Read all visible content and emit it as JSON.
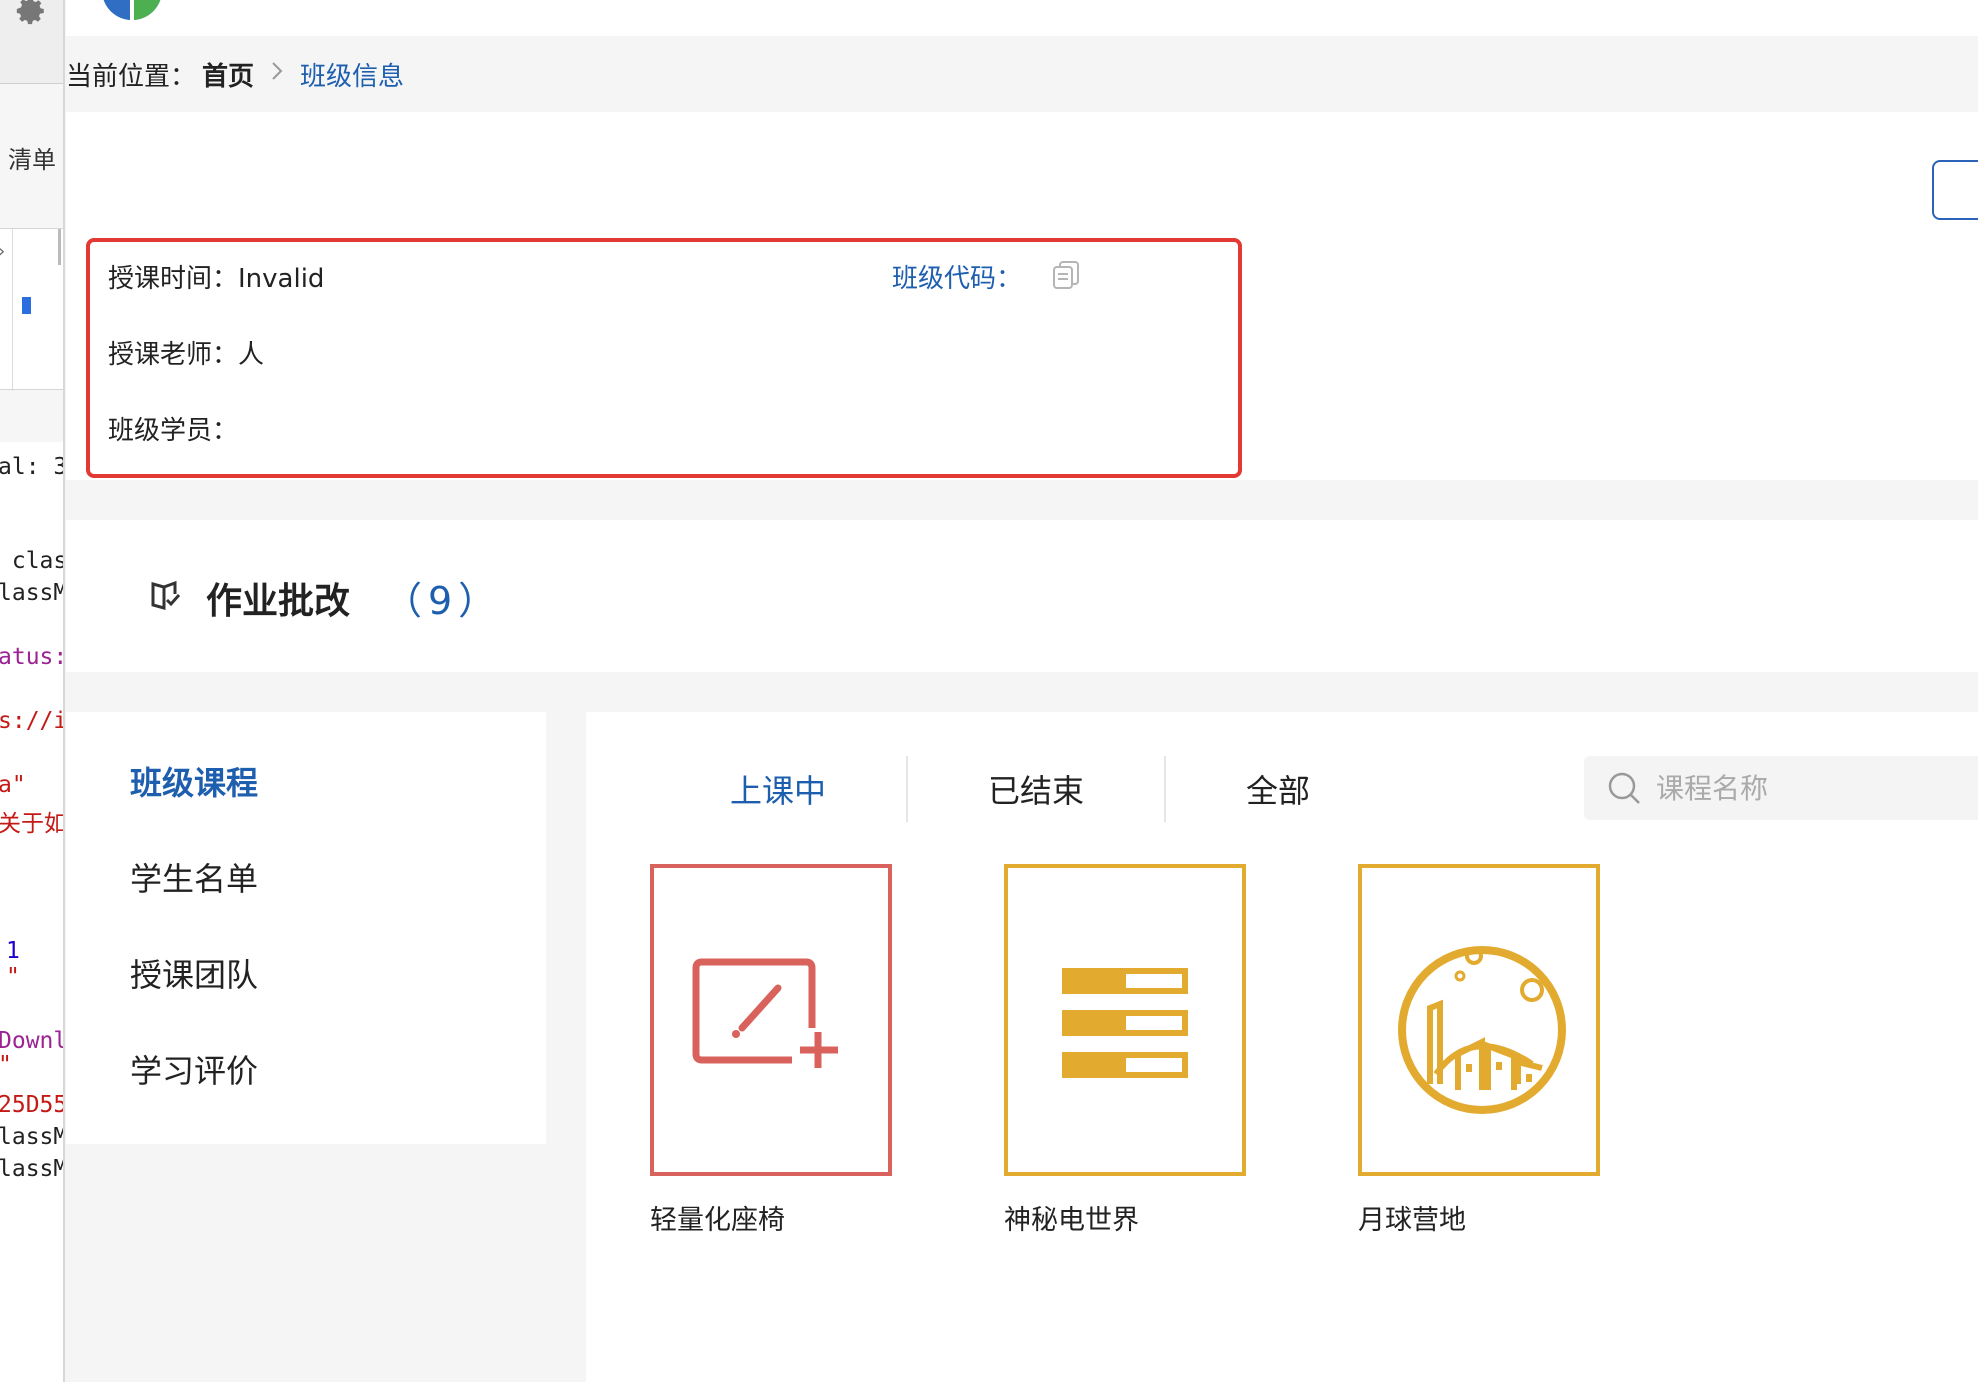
{
  "devtools": {
    "sidebar_label": "清单",
    "code_lines": [
      "al: 3",
      " clas",
      "lassM",
      "atus:",
      "s://i",
      "a\"",
      "关于如何",
      "1",
      "\"",
      "Downl",
      "\"",
      "25D55",
      "lassM",
      "lassM"
    ]
  },
  "breadcrumb": {
    "label": "当前位置：",
    "home": "首页",
    "separator": ">",
    "current": "班级信息"
  },
  "class_info": {
    "time_label": "授课时间：",
    "time_value": "Invalid",
    "teacher_label": "授课老师：",
    "teacher_value": "人",
    "students_label": "班级学员：",
    "students_value": "",
    "code_label": "班级代码："
  },
  "homework": {
    "title": "作业批改",
    "count": "（9）"
  },
  "side_menu": {
    "items": [
      {
        "label": "班级课程",
        "active": true
      },
      {
        "label": "学生名单",
        "active": false
      },
      {
        "label": "授课团队",
        "active": false
      },
      {
        "label": "学习评价",
        "active": false
      }
    ]
  },
  "tabs": [
    {
      "label": "上课中",
      "active": true
    },
    {
      "label": "已结束",
      "active": false
    },
    {
      "label": "全部",
      "active": false
    }
  ],
  "search": {
    "placeholder": "课程名称",
    "value": ""
  },
  "courses": [
    {
      "name": "轻量化座椅",
      "color": "#d9625c",
      "icon": "add-board-icon"
    },
    {
      "name": "神秘电世界",
      "color": "#e2ab2f",
      "icon": "stack-list-icon"
    },
    {
      "name": "月球营地",
      "color": "#e2ab2f",
      "icon": "moon-camp-icon"
    }
  ],
  "colors": {
    "accent": "#1d5fae",
    "highlight_border": "#e23a33"
  }
}
